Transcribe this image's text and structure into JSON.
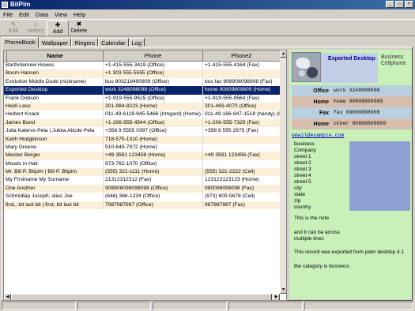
{
  "window": {
    "title": "BitPim"
  },
  "menu": [
    "File",
    "Edit",
    "Data",
    "View",
    "Help"
  ],
  "toolbar": {
    "edit_label": "Edit",
    "history_label": "History",
    "add_label": "Add",
    "delete_label": "Delete"
  },
  "tabs": [
    "PhoneBook",
    "Wallpaper",
    "Ringers",
    "Calendar",
    "Log"
  ],
  "table": {
    "columns": [
      "Name",
      "Phone",
      "Phone2"
    ],
    "rows": [
      [
        "Bartholemew Howes",
        "+1-415-555-3419 (Office)",
        "+1-415-555-4164 (Fax)"
      ],
      [
        "Bosm Hansen",
        "+1 303 555-5555 (Office)",
        ""
      ],
      [
        "Evolution Middle Dude (nickname)",
        "bus 903218490809 (Office)",
        "bus fax 908908098908 (Fax)"
      ],
      [
        "Exported Desktop",
        "work 3248098098 (Office)",
        "home 90809809809 (Home)"
      ],
      [
        "Frank Dobson",
        "+1-919-555-9515 (Office)",
        "+1-919-555-9564 (Fax)"
      ],
      [
        "Heidi Laso",
        "301-984-8223 (Home)",
        "301-469-4070 (Office)"
      ],
      [
        "Herbert Knack",
        "011-49-6118-945-5466 (Irmgard) (Home)",
        "011-49-166-847-1518 (handy) (Cell)"
      ],
      [
        "James Bond",
        "+1-206-555-4544 (Office)",
        "+1-206-555-7329 (Fax)"
      ],
      [
        "Julia Kalervo Pela | Jukka Abcde Pela",
        "+358 9 5555 0397 (Office)",
        "+358 9 555 2675 (Fax)"
      ],
      [
        "Keith Hodgkinson",
        "718-575-1310 (Home)",
        ""
      ],
      [
        "Mary Greene",
        "510-649-7872 (Home)",
        ""
      ],
      [
        "Meister Berger",
        "+49 3581 123456 (Home)",
        "+49 3581 123456 (Fax)"
      ],
      [
        "Moods in Hair",
        "973-762-1070 (Office)",
        ""
      ],
      [
        "Mr. Bill P. Bitpim | Bill P. Bitpim",
        "(555) 321-1111 (Home)",
        "(555) 321-2222 (Cell)"
      ],
      [
        "My Firstname My Surname",
        "21312312312 (Fax)",
        "123123123123 (Home)"
      ],
      [
        "One Another",
        "908908098098098 (Office)",
        "980098098098 (Fax)"
      ],
      [
        "Schmidlap Joseph; alias Joe",
        "(646) 366-1234 (Office)",
        "(973) 600-5678 (Cell)"
      ],
      [
        "first,; bit last bit | first; bit last bit",
        "7987987987 (Office)",
        "987987987 (Fax)"
      ]
    ],
    "selected_index": 3
  },
  "preview": {
    "title": "Exported Desktop",
    "categories": [
      "Business",
      "Cellphone"
    ],
    "phones": [
      {
        "label": "Office",
        "value": "work 3248098098"
      },
      {
        "label": "Home",
        "value": "home 90809809809"
      },
      {
        "label": "Fax",
        "value": "fax 09890898909"
      },
      {
        "label": "Home",
        "value": "other 90809809809"
      }
    ],
    "email": "email@example.com",
    "address": [
      "business",
      "Company",
      "street 1",
      "street 2",
      "street 3",
      "street 4",
      "street 5",
      "city",
      "state",
      "zip",
      "country"
    ],
    "notes": [
      "This is the note",
      "and it can be across",
      "multiple lines",
      "This record was exported from palm desktop 4.1",
      "the category is busniess"
    ]
  }
}
